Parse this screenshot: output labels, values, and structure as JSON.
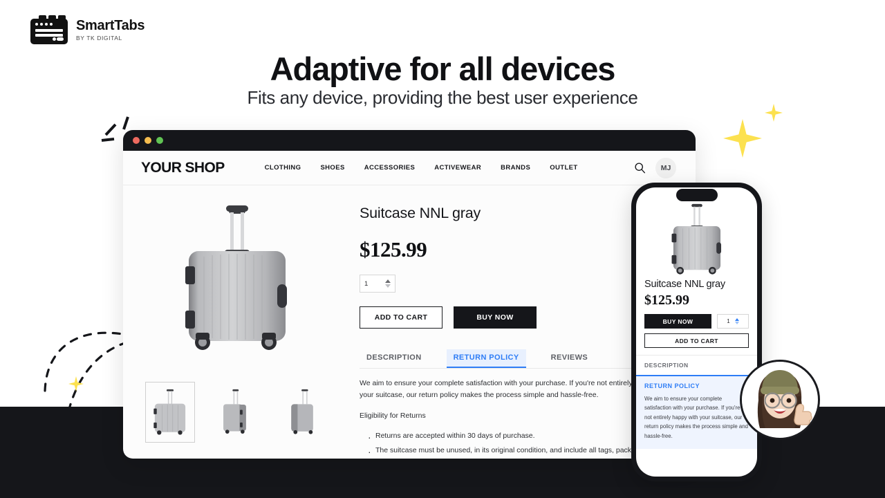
{
  "brand": {
    "name": "SmartTabs",
    "tagline": "BY TK DIGITAL",
    "logo_icon": "browser-tabs-icon"
  },
  "hero": {
    "headline": "Adaptive for all devices",
    "subheadline": "Fits any device, providing the best user experience"
  },
  "colors": {
    "accent_blue": "#2E7DF6",
    "accent_blue_bg": "#e8f0fe",
    "dark": "#15161a",
    "sparkle_yellow": "#FCE14F",
    "traffic_red": "#EE6A5F",
    "traffic_yellow": "#F5BD4F",
    "traffic_green": "#61C454"
  },
  "browser": {
    "traffic_lights": [
      "close-red",
      "minimize-yellow",
      "maximize-green"
    ],
    "shop": {
      "logo": "YOUR SHOP",
      "nav_links": [
        "CLOTHING",
        "SHOES",
        "ACCESSORIES",
        "ACTIVEWEAR",
        "BRANDS",
        "OUTLET"
      ],
      "search_icon": "search-icon",
      "account_initials": "MJ"
    },
    "product": {
      "title": "Suitcase NNL gray",
      "price": "$125.99",
      "quantity": "1",
      "add_to_cart_label": "ADD TO CART",
      "buy_now_label": "BUY NOW",
      "gallery_alt": "gray hardshell suitcase",
      "thumbnails": [
        "suitcase-front",
        "suitcase-angle",
        "suitcase-back"
      ]
    },
    "tabs": [
      {
        "label": "DESCRIPTION",
        "active": false
      },
      {
        "label": "RETURN POLICY",
        "active": true
      },
      {
        "label": "REVIEWS",
        "active": false
      }
    ],
    "tab_content": {
      "intro": "We aim to ensure your complete satisfaction with your purchase. If you're not entirely happy with your suitcase, our return policy makes the process simple and hassle-free.",
      "subheading": "Eligibility for Returns",
      "bullets": [
        "Returns are accepted within 30 days of purchase.",
        "The suitcase must be unused, in its original condition, and include all tags, packaging, and accessories."
      ]
    }
  },
  "phone": {
    "product": {
      "title": "Suitcase NNL gray",
      "price": "$125.99",
      "quantity": "1",
      "buy_now_label": "BUY NOW",
      "add_to_cart_label": "ADD TO CART"
    },
    "accordion": [
      {
        "label": "DESCRIPTION",
        "active": false,
        "body": ""
      },
      {
        "label": "RETURN POLICY",
        "active": true,
        "body": "We aim to ensure your complete satisfaction with your purchase. If you're not entirely happy with your suitcase, our return policy makes the process simple and hassle-free."
      }
    ]
  },
  "memoji": {
    "alt": "avatar-thumbs-up",
    "icon": "memoji-thumbs-up-icon"
  }
}
